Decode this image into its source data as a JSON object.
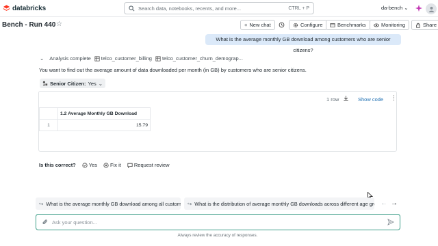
{
  "app": {
    "brand": "databricks",
    "workspace": "da-bench",
    "brand_color": "#ff3621",
    "accent": "#2272b4"
  },
  "search": {
    "placeholder": "Search data, notebooks, recents, and more...",
    "shortcut": "CTRL + P"
  },
  "page": {
    "title": "Bench - Run 440"
  },
  "toolbar": {
    "new_chat": "New chat",
    "configure": "Configure",
    "benchmarks": "Benchmarks",
    "monitoring": "Monitoring",
    "share": "Share"
  },
  "conversation": {
    "question": "What is the average monthly GB download among customers who are senior citizens?",
    "status": "Analysis complete",
    "tables": [
      "telco_customer_billing",
      "telco_customer_churn_demograp..."
    ],
    "summary": "You want to find out the average amount of data downloaded per month (in GB) by customers who are senior citizens.",
    "filter": {
      "label": "Senior Citizen:",
      "value": "Yes"
    }
  },
  "result": {
    "row_count": "1 row",
    "show_code": "Show code",
    "columns": [
      "",
      "1.2 Average Monthly GB Download"
    ],
    "rows": [
      [
        "1",
        "15.79"
      ]
    ]
  },
  "feedback": {
    "question": "Is this correct?",
    "yes": "Yes",
    "fix": "Fix it",
    "review": "Request review"
  },
  "suggestions": [
    "What is the average monthly GB download among all customers?",
    "What is the distribution of average monthly GB downloads across different age groups?"
  ],
  "input": {
    "placeholder": "Ask your question..."
  },
  "disclaimer": "Always review the accuracy of responses."
}
